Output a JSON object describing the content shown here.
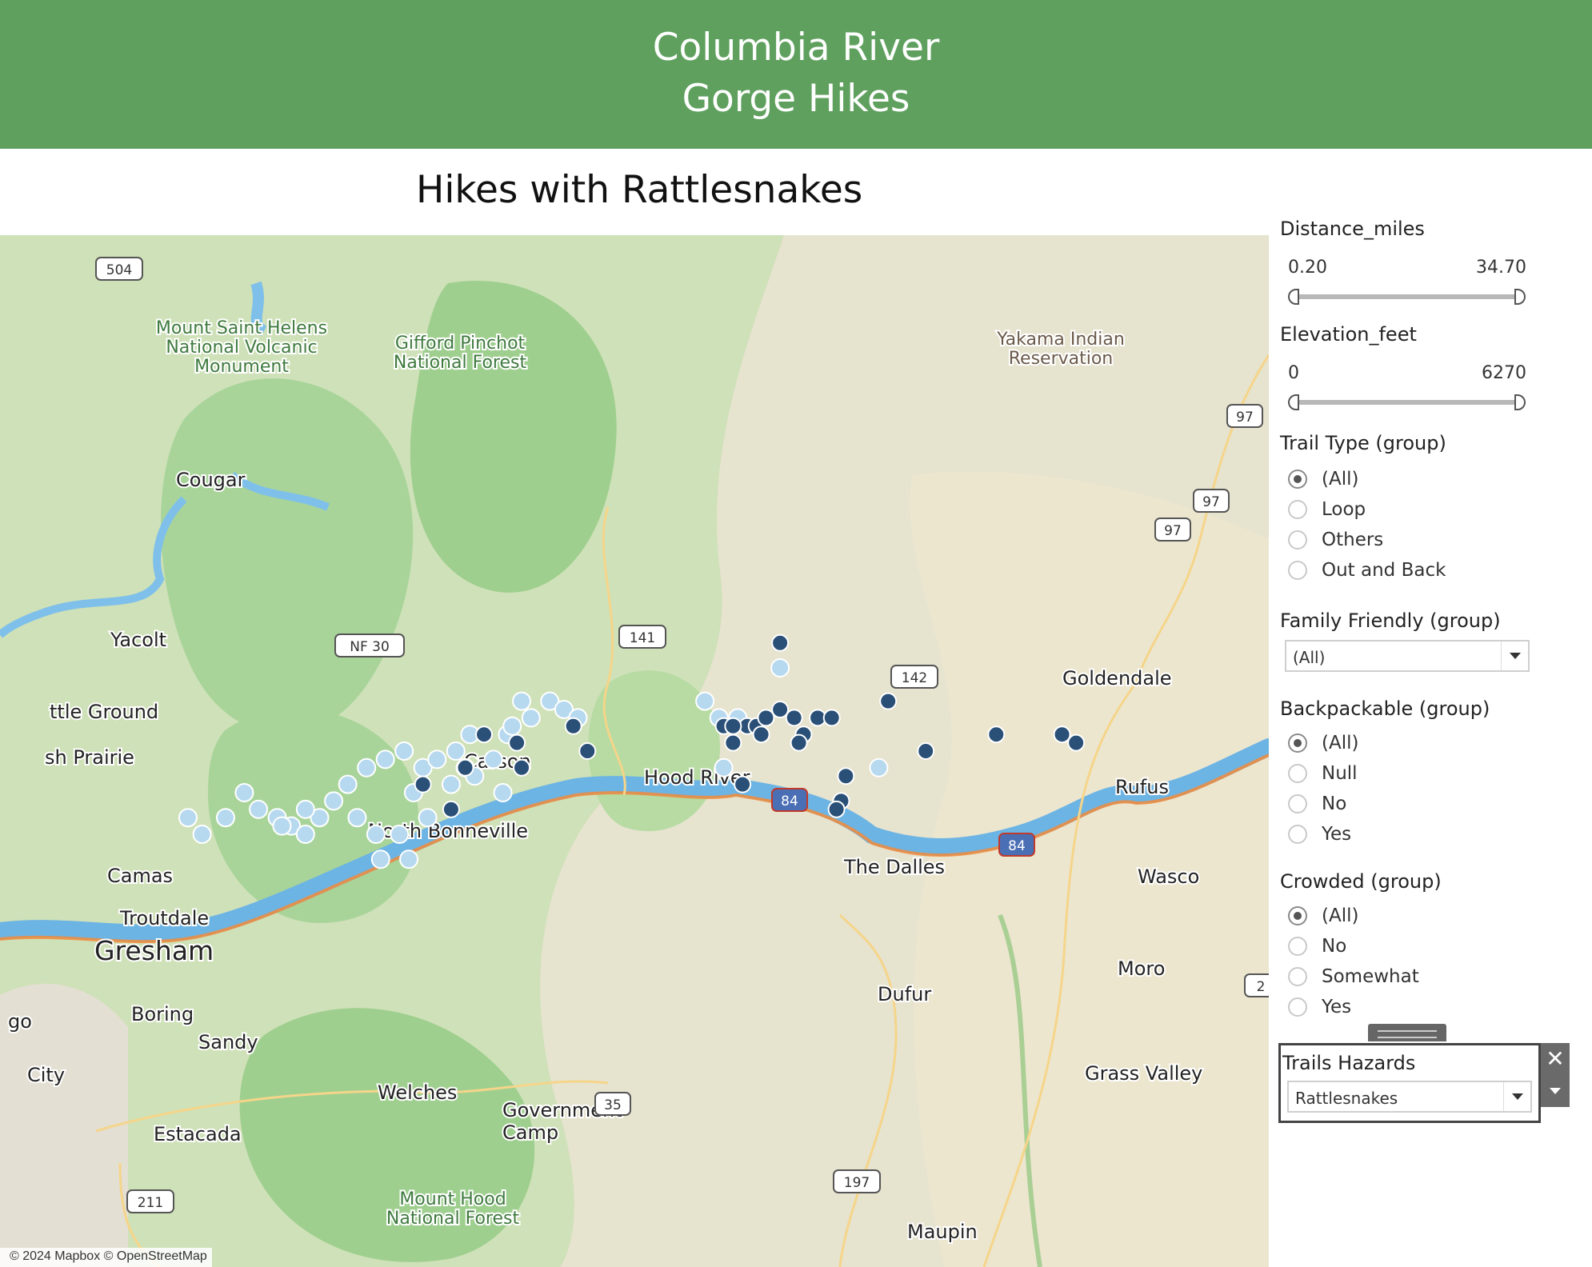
{
  "header": {
    "line1": "Columbia River",
    "line2": "Gorge Hikes"
  },
  "viz_title": "Hikes with Rattlesnakes",
  "map": {
    "attribution": "© 2024 Mapbox © OpenStreetMap",
    "places": [
      {
        "text": "Mount Saint Helens",
        "cls": "park"
      },
      {
        "text": "National Volcanic",
        "cls": "park"
      },
      {
        "text": "Monument",
        "cls": "park"
      },
      {
        "text": "Gifford Pinchot",
        "cls": "park"
      },
      {
        "text": "National Forest",
        "cls": "park"
      },
      {
        "text": "Yakama Indian",
        "cls": "res"
      },
      {
        "text": "Reservation",
        "cls": "res"
      },
      {
        "text": "Cougar",
        "cls": "town"
      },
      {
        "text": "Yacolt",
        "cls": "town"
      },
      {
        "text": "ttle Ground",
        "cls": "town"
      },
      {
        "text": "sh Prairie",
        "cls": "town"
      },
      {
        "text": "Carson",
        "cls": "town"
      },
      {
        "text": "Goldendale",
        "cls": "town"
      },
      {
        "text": "Rufus",
        "cls": "town"
      },
      {
        "text": "Camas",
        "cls": "town"
      },
      {
        "text": "Troutdale",
        "cls": "town"
      },
      {
        "text": "Gresham",
        "cls": "city"
      },
      {
        "text": "Wasco",
        "cls": "town"
      },
      {
        "text": "The Dalles",
        "cls": "town"
      },
      {
        "text": "Hood River",
        "cls": "town"
      },
      {
        "text": "North Bonneville",
        "cls": "town"
      },
      {
        "text": "Moro",
        "cls": "town"
      },
      {
        "text": "Dufur",
        "cls": "town"
      },
      {
        "text": "Boring",
        "cls": "town"
      },
      {
        "text": "Sandy",
        "cls": "town"
      },
      {
        "text": "go",
        "cls": "town"
      },
      {
        "text": "City",
        "cls": "town"
      },
      {
        "text": "Welches",
        "cls": "town"
      },
      {
        "text": "Government",
        "cls": "town"
      },
      {
        "text": "Camp",
        "cls": "town"
      },
      {
        "text": "Estacada",
        "cls": "town"
      },
      {
        "text": "Grass Valley",
        "cls": "town"
      },
      {
        "text": "Mount Hood",
        "cls": "park"
      },
      {
        "text": "National Forest",
        "cls": "park"
      },
      {
        "text": "Maupin",
        "cls": "town"
      }
    ],
    "shields": [
      "504",
      "NF 30",
      "141",
      "142",
      "97",
      "97",
      "97",
      "84",
      "84",
      "35",
      "211",
      "197",
      "2"
    ],
    "hikes_with_rattlesnakes": [
      {
        "lon": -121.29,
        "lat": 45.81
      },
      {
        "lon": -121.06,
        "lat": 45.74
      },
      {
        "lon": -121.92,
        "lat": 45.7
      },
      {
        "lon": -121.73,
        "lat": 45.71
      },
      {
        "lon": -121.7,
        "lat": 45.68
      },
      {
        "lon": -121.41,
        "lat": 45.71
      },
      {
        "lon": -121.39,
        "lat": 45.69
      },
      {
        "lon": -121.36,
        "lat": 45.71
      },
      {
        "lon": -121.34,
        "lat": 45.71
      },
      {
        "lon": -121.33,
        "lat": 45.7
      },
      {
        "lon": -121.39,
        "lat": 45.71
      },
      {
        "lon": -121.32,
        "lat": 45.72
      },
      {
        "lon": -121.29,
        "lat": 45.73
      },
      {
        "lon": -121.26,
        "lat": 45.72
      },
      {
        "lon": -121.24,
        "lat": 45.7
      },
      {
        "lon": -121.25,
        "lat": 45.69
      },
      {
        "lon": -121.21,
        "lat": 45.72
      },
      {
        "lon": -121.18,
        "lat": 45.72
      },
      {
        "lon": -121.37,
        "lat": 45.64
      },
      {
        "lon": -121.15,
        "lat": 45.65
      },
      {
        "lon": -121.16,
        "lat": 45.62
      },
      {
        "lon": -121.17,
        "lat": 45.61
      },
      {
        "lon": -120.98,
        "lat": 45.68
      },
      {
        "lon": -120.83,
        "lat": 45.7
      },
      {
        "lon": -120.69,
        "lat": 45.7
      },
      {
        "lon": -120.66,
        "lat": 45.69
      },
      {
        "lon": -121.85,
        "lat": 45.69
      },
      {
        "lon": -121.96,
        "lat": 45.66
      },
      {
        "lon": -121.84,
        "lat": 45.66
      },
      {
        "lon": -122.05,
        "lat": 45.64
      },
      {
        "lon": -121.99,
        "lat": 45.61
      }
    ]
  },
  "filters": {
    "distance": {
      "title": "Distance_miles",
      "min": "0.20",
      "max": "34.70",
      "range_fraction": [
        0,
        1
      ]
    },
    "elevation": {
      "title": "Elevation_feet",
      "min": "0",
      "max": "6270",
      "range_fraction": [
        0,
        1
      ]
    },
    "trail_type": {
      "title": "Trail Type (group)",
      "options": [
        "(All)",
        "Loop",
        "Others",
        "Out and  Back"
      ],
      "selected": "(All)"
    },
    "family_friendly": {
      "title": "Family Friendly (group)",
      "value": "(All)"
    },
    "backpackable": {
      "title": "Backpackable (group)",
      "options": [
        "(All)",
        "Null",
        "No",
        "Yes"
      ],
      "selected": "(All)"
    },
    "crowded": {
      "title": "Crowded (group)",
      "options": [
        "(All)",
        "No",
        "Somewhat",
        "Yes"
      ],
      "selected": "(All)"
    },
    "trails_hazards": {
      "title": "Trails Hazards",
      "value": "Rattlesnakes"
    }
  },
  "colors": {
    "header": "#5fa05f",
    "dot_dark": "#2a5078",
    "dot_light": "#b7d9ef",
    "river": "#6cb4e4",
    "forest": "#a8d49a"
  }
}
